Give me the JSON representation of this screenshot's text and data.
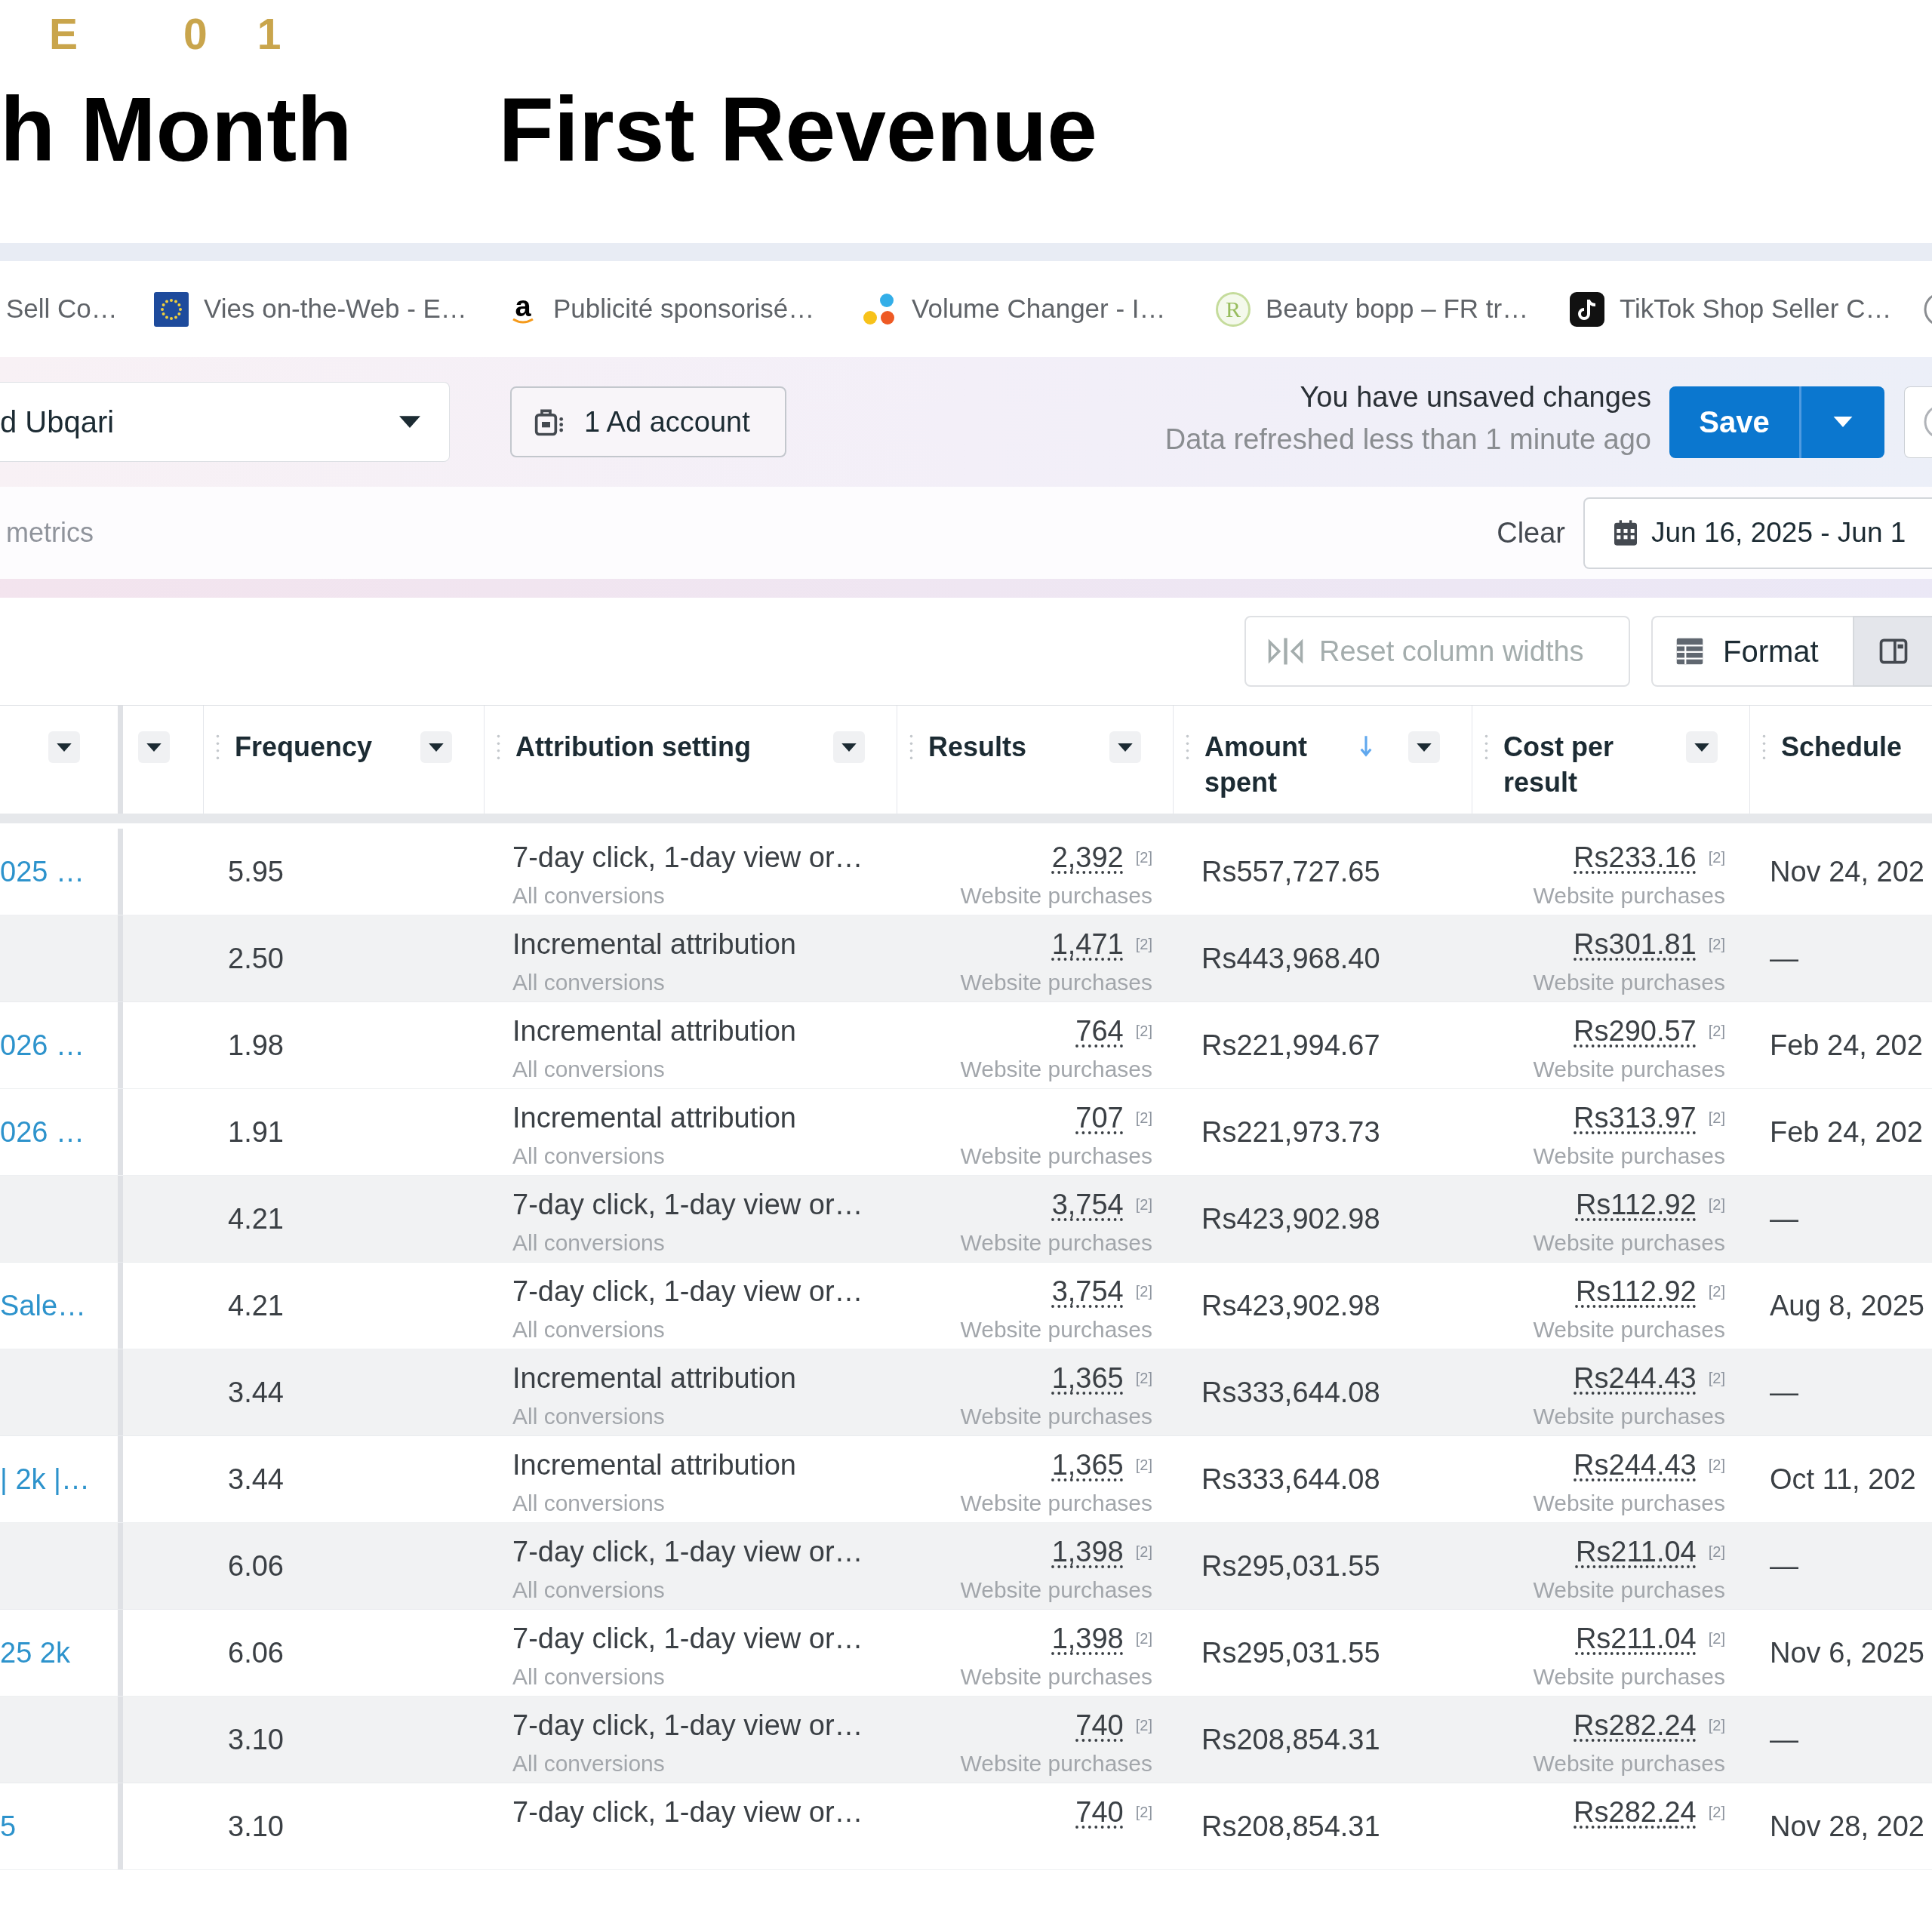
{
  "header": {
    "kicker": [
      "E",
      "01"
    ],
    "headline": [
      "h Month",
      "First Revenue"
    ]
  },
  "bookmarks": [
    {
      "label": "Sell Co…"
    },
    {
      "label": "Vies on-the-Web - E…"
    },
    {
      "label": "Publicité sponsorisé…",
      "logo_text": "a"
    },
    {
      "label": "Volume Changer - I…"
    },
    {
      "label": "Beauty bopp – FR tr…",
      "logo_text": "R"
    },
    {
      "label": "TikTok Shop Seller C…"
    }
  ],
  "top_bar": {
    "account": "d Ubqari",
    "ad_account_button": "1 Ad account",
    "status": "You have unsaved changes",
    "refreshed": "Data refreshed less than 1 minute ago",
    "save_button": "Save"
  },
  "filter_bar": {
    "search": {
      "placeholder": "metrics"
    },
    "clear_button": "Clear",
    "date_range": "Jun 16, 2025 - Jun 1"
  },
  "toolbar": {
    "reset_columns": {
      "label": "Reset column widths",
      "disabled": true
    },
    "format_button": "Format"
  },
  "table": {
    "columns": [
      {
        "menu_button": true,
        "sorted": false
      },
      {
        "menu_button": true,
        "sorted": false
      },
      {
        "label": "Frequency",
        "menu_button": true,
        "sorted": false
      },
      {
        "label": "Attribution setting",
        "menu_button": true,
        "sorted": false
      },
      {
        "label": "Results",
        "menu_button": true,
        "sorted": false
      },
      {
        "label": "Amount spent",
        "menu_button": true,
        "sorted": true
      },
      {
        "label": "Cost per result",
        "menu_button": true,
        "sorted": false
      },
      {
        "label": "Schedule",
        "menu_button": false,
        "sorted": false
      }
    ],
    "rows": [
      {
        "name": "025 …",
        "highlighted": false,
        "frequency": "5.95",
        "attribution": "7-day click, 1-day view or…",
        "attribution_detail": "All conversions",
        "results": "2,392",
        "results_mark": "[2]",
        "results_type": "Website purchases",
        "amount_spent": "Rs557,727.65",
        "cost_per_result": "Rs233.16",
        "cost_mark": "[2]",
        "cost_type": "Website purchases",
        "schedule": "Nov 24, 202"
      },
      {
        "highlighted": true,
        "frequency": "2.50",
        "attribution": "Incremental attribution",
        "attribution_detail": "All conversions",
        "results": "1,471",
        "results_mark": "[2]",
        "results_type": "Website purchases",
        "amount_spent": "Rs443,968.40",
        "cost_per_result": "Rs301.81",
        "cost_mark": "[2]",
        "cost_type": "Website purchases",
        "schedule": "—"
      },
      {
        "name": "026 …",
        "highlighted": false,
        "frequency": "1.98",
        "attribution": "Incremental attribution",
        "attribution_detail": "All conversions",
        "results": "764",
        "results_mark": "[2]",
        "results_type": "Website purchases",
        "amount_spent": "Rs221,994.67",
        "cost_per_result": "Rs290.57",
        "cost_mark": "[2]",
        "cost_type": "Website purchases",
        "schedule": "Feb 24, 202"
      },
      {
        "name": "026 …",
        "highlighted": false,
        "frequency": "1.91",
        "attribution": "Incremental attribution",
        "attribution_detail": "All conversions",
        "results": "707",
        "results_mark": "[2]",
        "results_type": "Website purchases",
        "amount_spent": "Rs221,973.73",
        "cost_per_result": "Rs313.97",
        "cost_mark": "[2]",
        "cost_type": "Website purchases",
        "schedule": "Feb 24, 202"
      },
      {
        "highlighted": true,
        "frequency": "4.21",
        "attribution": "7-day click, 1-day view or…",
        "attribution_detail": "All conversions",
        "results": "3,754",
        "results_mark": "[2]",
        "results_type": "Website purchases",
        "amount_spent": "Rs423,902.98",
        "cost_per_result": "Rs112.92",
        "cost_mark": "[2]",
        "cost_type": "Website purchases",
        "schedule": "—"
      },
      {
        "name": "Sale…",
        "highlighted": false,
        "frequency": "4.21",
        "attribution": "7-day click, 1-day view or…",
        "attribution_detail": "All conversions",
        "results": "3,754",
        "results_mark": "[2]",
        "results_type": "Website purchases",
        "amount_spent": "Rs423,902.98",
        "cost_per_result": "Rs112.92",
        "cost_mark": "[2]",
        "cost_type": "Website purchases",
        "schedule": "Aug 8, 2025"
      },
      {
        "highlighted": true,
        "frequency": "3.44",
        "attribution": "Incremental attribution",
        "attribution_detail": "All conversions",
        "results": "1,365",
        "results_mark": "[2]",
        "results_type": "Website purchases",
        "amount_spent": "Rs333,644.08",
        "cost_per_result": "Rs244.43",
        "cost_mark": "[2]",
        "cost_type": "Website purchases",
        "schedule": "—"
      },
      {
        "name": "| 2k |…",
        "highlighted": false,
        "frequency": "3.44",
        "attribution": "Incremental attribution",
        "attribution_detail": "All conversions",
        "results": "1,365",
        "results_mark": "[2]",
        "results_type": "Website purchases",
        "amount_spent": "Rs333,644.08",
        "cost_per_result": "Rs244.43",
        "cost_mark": "[2]",
        "cost_type": "Website purchases",
        "schedule": "Oct 11, 202"
      },
      {
        "highlighted": true,
        "frequency": "6.06",
        "attribution": "7-day click, 1-day view or…",
        "attribution_detail": "All conversions",
        "results": "1,398",
        "results_mark": "[2]",
        "results_type": "Website purchases",
        "amount_spent": "Rs295,031.55",
        "cost_per_result": "Rs211.04",
        "cost_mark": "[2]",
        "cost_type": "Website purchases",
        "schedule": "—"
      },
      {
        "name": "25 2k",
        "highlighted": false,
        "frequency": "6.06",
        "attribution": "7-day click, 1-day view or…",
        "attribution_detail": "All conversions",
        "results": "1,398",
        "results_mark": "[2]",
        "results_type": "Website purchases",
        "amount_spent": "Rs295,031.55",
        "cost_per_result": "Rs211.04",
        "cost_mark": "[2]",
        "cost_type": "Website purchases",
        "schedule": "Nov 6, 2025"
      },
      {
        "highlighted": true,
        "frequency": "3.10",
        "attribution": "7-day click, 1-day view or…",
        "attribution_detail": "All conversions",
        "results": "740",
        "results_mark": "[2]",
        "results_type": "Website purchases",
        "amount_spent": "Rs208,854.31",
        "cost_per_result": "Rs282.24",
        "cost_mark": "[2]",
        "cost_type": "Website purchases",
        "schedule": "—"
      },
      {
        "name": "5",
        "highlighted": false,
        "frequency": "3.10",
        "attribution": "7-day click, 1-day view or…",
        "results": "740",
        "results_mark": "[2]",
        "amount_spent": "Rs208,854.31",
        "cost_per_result": "Rs282.24",
        "cost_mark": "[2]",
        "schedule": "Nov 28, 202"
      }
    ]
  }
}
